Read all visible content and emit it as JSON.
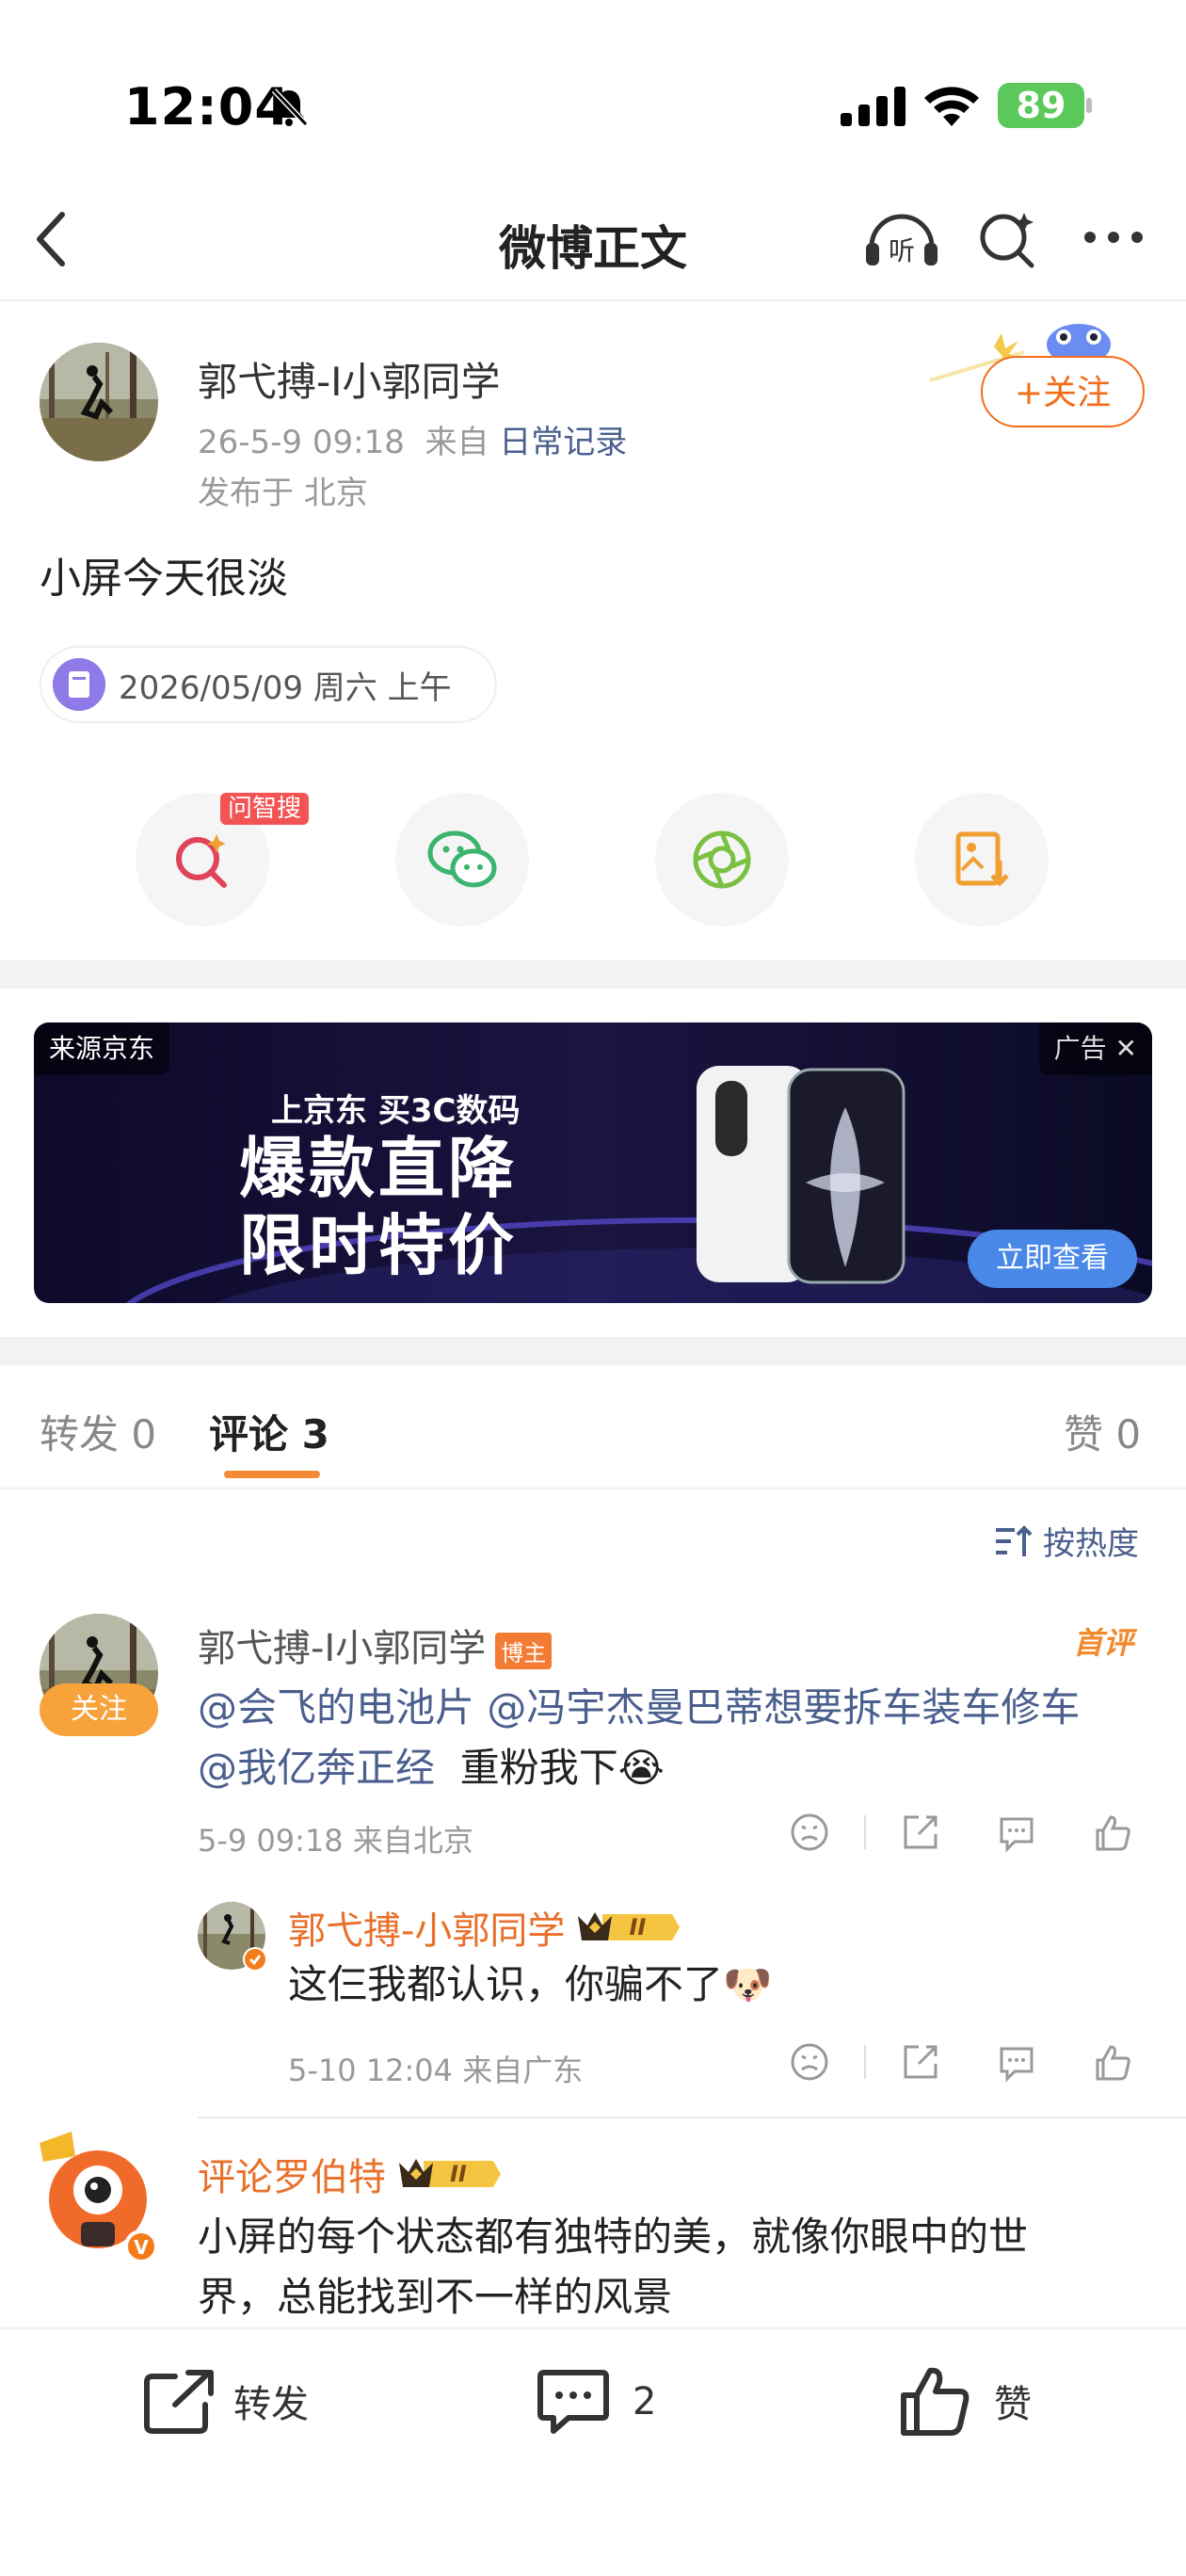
{
  "status_bar": {
    "time": "12:04",
    "battery": "89"
  },
  "nav": {
    "title": "微博正文"
  },
  "post": {
    "author": "郭弋搏-I小郭同学",
    "timestamp": "26-5-9 09:18",
    "from_label": "来自",
    "source": "日常记录",
    "location": "发布于 北京",
    "follow_label": "+关注",
    "text": "小屏今天很淡",
    "topic": "2026/05/09 周六 上午",
    "wenzhisou_tag": "问智搜"
  },
  "ad": {
    "source": "来源京东",
    "tag": "广告",
    "subtitle": "上京东 买3C数码",
    "headline_1": "爆款直降",
    "headline_2": "限时特价",
    "cta": "立即查看"
  },
  "tabs": [
    {
      "label": "转发 0"
    },
    {
      "label": "评论 3"
    },
    {
      "label": "赞 0"
    }
  ],
  "sort_label": "按热度",
  "comments": [
    {
      "author": "郭弋搏-I小郭同学",
      "badge": "博主",
      "first_badge": "首评",
      "follow_label": "关注",
      "mention_1": "@会飞的电池片",
      "mention_2": "@冯宇杰曼巴蒂想要拆车装车修车",
      "mention_3": "@我亿奔正经",
      "text": "重粉我下",
      "emoji": "😭",
      "meta": "5-9 09:18 来自北京"
    },
    {
      "author": "郭弋搏-小郭同学",
      "crown_level": "II",
      "text": "这仨我都认识，你骗不了",
      "emoji": "🐶",
      "meta": "5-10 12:04 来自广东"
    },
    {
      "author": "评论罗伯特",
      "crown_level": "II",
      "text_line_1": "小屏的每个状态都有独特的美，就像你眼中的世",
      "text_line_2": "界，总能找到不一样的风景"
    }
  ],
  "bottom_bar": {
    "repost": "转发",
    "comment_count": "2",
    "like": "赞"
  },
  "colors": {
    "accent": "#f26d1a",
    "link": "#4b5f8e",
    "battery": "#5ac85a"
  }
}
